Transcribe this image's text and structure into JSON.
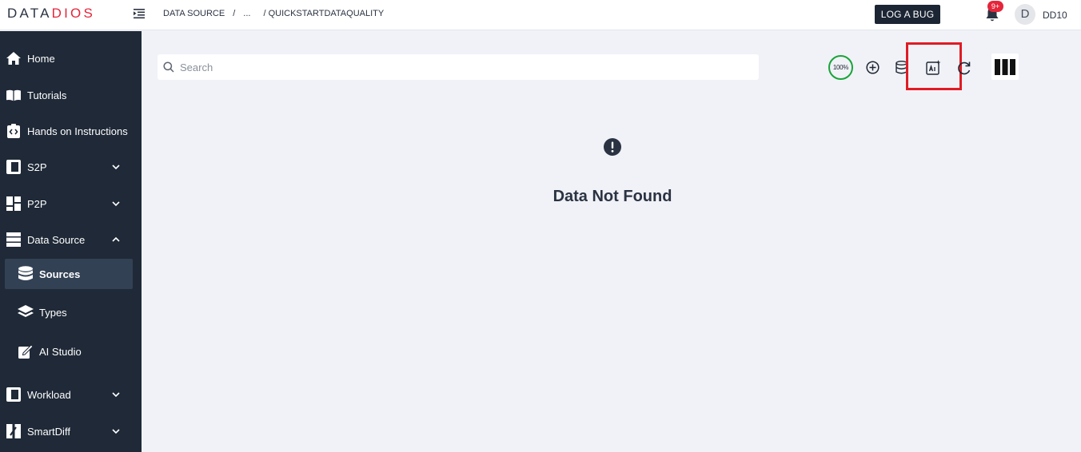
{
  "brand": {
    "part1": "DATA",
    "part2": "DIOS"
  },
  "breadcrumb": {
    "item1": "DATA SOURCE",
    "sep1": "/",
    "item2": "...",
    "item3": "/ QUICKSTARTDATAQUALITY"
  },
  "header": {
    "log_bug_label": "LOG A BUG",
    "notification_badge": "9+",
    "avatar_initial": "D",
    "username": "DD10"
  },
  "sidebar": {
    "items": [
      {
        "label": "Home",
        "icon": "home-icon"
      },
      {
        "label": "Tutorials",
        "icon": "book-icon"
      },
      {
        "label": "Hands on Instructions",
        "icon": "instructions-icon"
      },
      {
        "label": "S2P",
        "icon": "s2p-icon",
        "expandable": true
      },
      {
        "label": "P2P",
        "icon": "p2p-icon",
        "expandable": true
      },
      {
        "label": "Data Source",
        "icon": "server-icon",
        "expanded": true
      },
      {
        "label": "Workload",
        "icon": "workload-icon",
        "expandable": true
      },
      {
        "label": "SmartDiff",
        "icon": "smartdiff-icon",
        "expandable": true
      }
    ],
    "sub_items": [
      {
        "label": "Sources",
        "icon": "database-icon",
        "active": true
      },
      {
        "label": "Types",
        "icon": "layers-icon"
      },
      {
        "label": "AI Studio",
        "icon": "edit-icon"
      }
    ]
  },
  "search": {
    "placeholder": "Search",
    "value": ""
  },
  "toolbar": {
    "progress_label": "100%"
  },
  "empty_state": {
    "message": "Data Not Found"
  },
  "colors": {
    "sidebar_bg": "#1f2937",
    "accent_red": "#e5253a",
    "progress_green": "#1aa33a",
    "highlight_red": "#e01b24"
  }
}
